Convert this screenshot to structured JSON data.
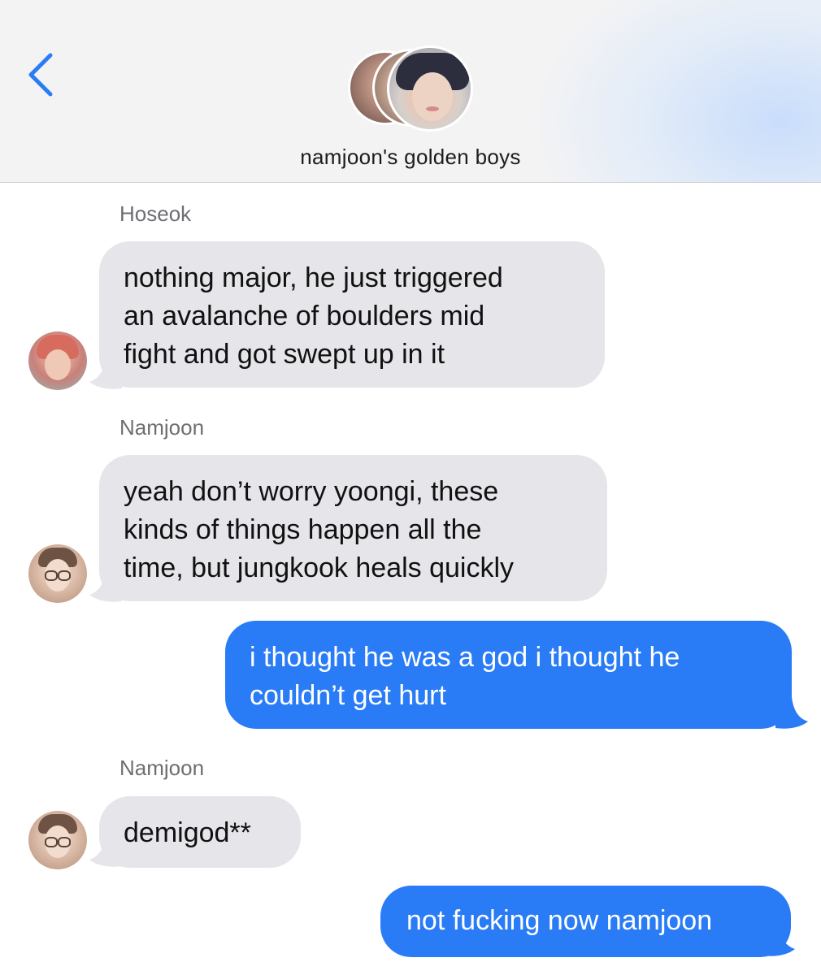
{
  "header": {
    "back_icon": "chevron-left-icon",
    "group_name": "namjoon's golden boys",
    "accent": "#2a7cf6"
  },
  "messages": [
    {
      "sender": "Hoseok",
      "direction": "received",
      "text": "nothing major, he just triggered\nan avalanche of boulders mid\nfight and got swept up in it"
    },
    {
      "sender": "Namjoon",
      "direction": "received",
      "text": "yeah don’t worry yoongi, these\nkinds of things happen all the\ntime, but jungkook heals quickly"
    },
    {
      "sender": "",
      "direction": "sent",
      "text": "i thought he was a god i thought he\ncouldn’t get hurt"
    },
    {
      "sender": "Namjoon",
      "direction": "received",
      "text": "demigod**"
    },
    {
      "sender": "",
      "direction": "sent",
      "text": "not fucking now namjoon"
    }
  ],
  "colors": {
    "received_bubble": "#e5e5ea",
    "sent_bubble": "#2a7cf6"
  }
}
